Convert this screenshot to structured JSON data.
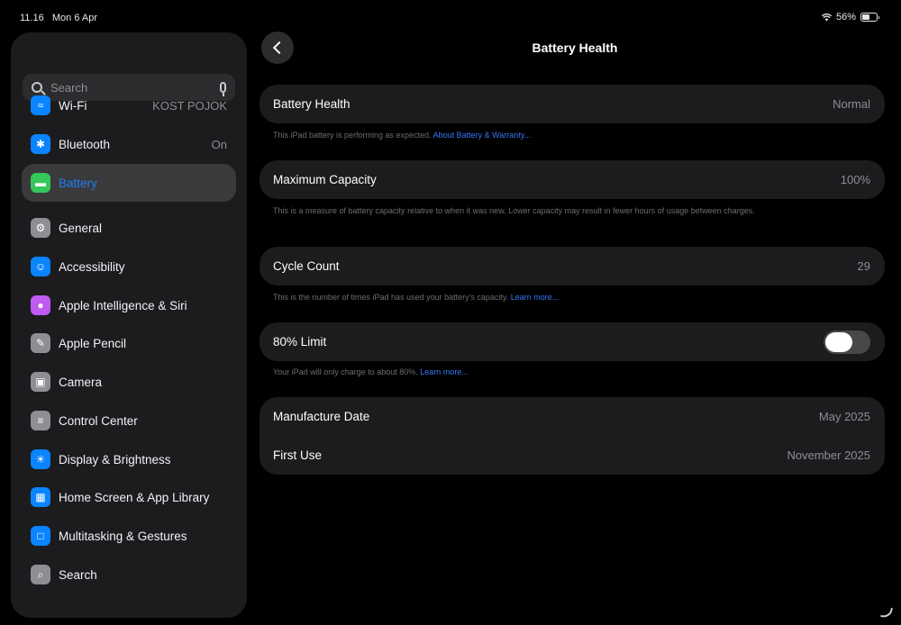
{
  "status_bar": {
    "time": "11.16",
    "date": "Mon 6 Apr",
    "battery_percent": "56%",
    "battery_level": 0.56
  },
  "sidebar": {
    "search_placeholder": "Search",
    "items": [
      {
        "label": "Wi-Fi",
        "value": "KOST POJOK",
        "icon": "wifi-icon",
        "color": "#0a84ff"
      },
      {
        "label": "Bluetooth",
        "value": "On",
        "icon": "bluetooth-icon",
        "color": "#0a84ff"
      },
      {
        "label": "Battery",
        "value": "",
        "icon": "battery-icon",
        "color": "#34c759",
        "selected": true
      },
      {
        "label": "General",
        "value": "",
        "icon": "gear-icon",
        "color": "#8e8e93"
      },
      {
        "label": "Accessibility",
        "value": "",
        "icon": "accessibility-icon",
        "color": "#0a84ff"
      },
      {
        "label": "Apple Intelligence & Siri",
        "value": "",
        "icon": "siri-icon",
        "color": "#bf5af2"
      },
      {
        "label": "Apple Pencil",
        "value": "",
        "icon": "pencil-icon",
        "color": "#8e8e93"
      },
      {
        "label": "Camera",
        "value": "",
        "icon": "camera-icon",
        "color": "#8e8e93"
      },
      {
        "label": "Control Center",
        "value": "",
        "icon": "control-center-icon",
        "color": "#8e8e93"
      },
      {
        "label": "Display & Brightness",
        "value": "",
        "icon": "brightness-icon",
        "color": "#0a84ff"
      },
      {
        "label": "Home Screen & App Library",
        "value": "",
        "icon": "home-screen-icon",
        "color": "#0a84ff"
      },
      {
        "label": "Multitasking & Gestures",
        "value": "",
        "icon": "multitasking-icon",
        "color": "#0a84ff"
      },
      {
        "label": "Search",
        "value": "",
        "icon": "search-icon",
        "color": "#8e8e93"
      }
    ]
  },
  "main": {
    "title": "Battery Health",
    "battery_health": {
      "label": "Battery Health",
      "value": "Normal",
      "note": "This iPad battery is performing as expected.",
      "link": "About Battery & Warranty..."
    },
    "max_capacity": {
      "label": "Maximum Capacity",
      "value": "100%",
      "note": "This is a measure of battery capacity relative to when it was new. Lower capacity may result in fewer hours of usage between charges."
    },
    "cycle_count": {
      "label": "Cycle Count",
      "value": "29",
      "note": "This is the number of times iPad has used your battery's capacity.",
      "link": "Learn more..."
    },
    "limit": {
      "label": "80% Limit",
      "enabled": false,
      "note": "Your iPad will only charge to about 80%.",
      "link": "Learn more..."
    },
    "dates": {
      "manufacture_label": "Manufacture Date",
      "manufacture_value": "May 2025",
      "first_use_label": "First Use",
      "first_use_value": "November 2025"
    }
  }
}
